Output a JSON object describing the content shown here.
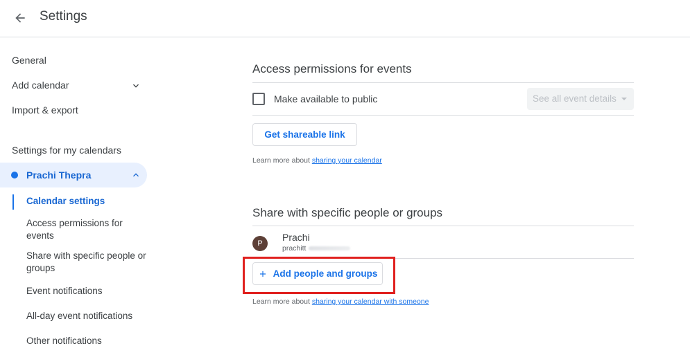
{
  "header": {
    "title": "Settings",
    "back_icon": "arrow-back-icon"
  },
  "sidebar": {
    "items": [
      {
        "label": "General"
      },
      {
        "label": "Add calendar"
      },
      {
        "label": "Import & export"
      }
    ],
    "my_calendars_heading": "Settings for my calendars",
    "calendar": {
      "name": "Prachi Thepra",
      "color": "#1a73e8"
    },
    "sub_items": [
      {
        "label": "Calendar settings"
      },
      {
        "label": "Access permissions for events"
      },
      {
        "label": "Share with specific people or groups"
      },
      {
        "label": "Event notifications"
      },
      {
        "label": "All-day event notifications"
      },
      {
        "label": "Other notifications"
      }
    ]
  },
  "access": {
    "title": "Access permissions for events",
    "public_label": "Make available to public",
    "public_checked": false,
    "select_value": "See all event details",
    "link_button": "Get shareable link",
    "learn_prefix": "Learn more about ",
    "learn_link": "sharing your calendar"
  },
  "share": {
    "title": "Share with specific people or groups",
    "person": {
      "initial": "P",
      "name": "Prachi",
      "email": "prachitt",
      "avatar_color": "#5d4037"
    },
    "add_button": "Add people and groups",
    "learn_prefix": "Learn more about ",
    "learn_link": "sharing your calendar with someone"
  },
  "colors": {
    "accent": "#1a73e8",
    "highlight": "#e0211f"
  }
}
